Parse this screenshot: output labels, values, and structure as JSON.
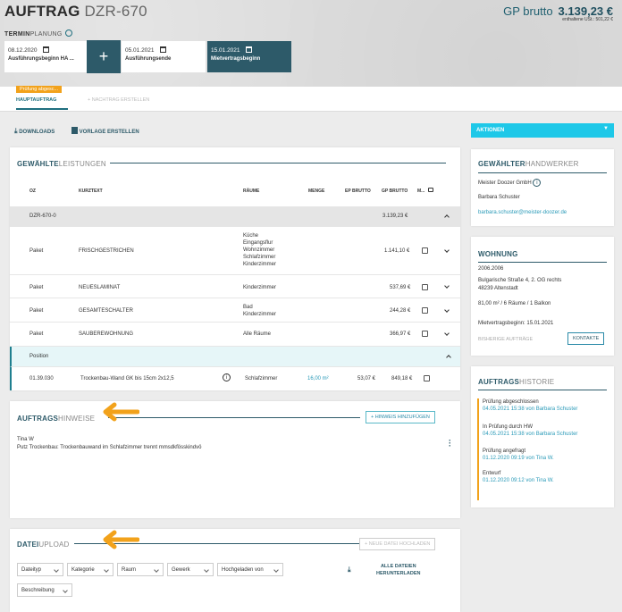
{
  "header": {
    "title_bold": "AUFTRAG",
    "title_id": "DZR-670",
    "gp_label": "GP brutto",
    "gp_amount": "3.139,23 €",
    "ust": "enthaltene USt.: 501,22 €",
    "termin_bold": "TERMIN",
    "termin_rest": "PLANUNG"
  },
  "steps": [
    {
      "date": "08.12.2020",
      "label": "Ausführungsbeginn HA ..."
    },
    {
      "date": "05.01.2021",
      "label": "Ausführungsende"
    },
    {
      "date": "15.01.2021",
      "label": "Mietvertragsbeginn"
    }
  ],
  "tabs": {
    "badge": "Prüfung abgesc...",
    "main": "HAUPTAUFTRAG",
    "add": "NACHTRAG ERSTELLEN"
  },
  "toolbar": {
    "downloads": "DOWNLOADS",
    "vorlage": "VORLAGE ERSTELLEN",
    "aktionen": "AKTIONEN"
  },
  "leistungen": {
    "title_bold": "GEWÄHLTE",
    "title_rest": "LEISTUNGEN",
    "cols": [
      "OZ",
      "KURZTEXT",
      "RÄUME",
      "MENGE",
      "EP BRUTTO",
      "GP BRUTTO",
      "M..."
    ],
    "group": {
      "oz": "DZR-670-0",
      "gp": "3.139,23 €"
    },
    "rows": [
      {
        "oz": "Paket",
        "text": "FRISCHGESTRICHEN",
        "raeume": [
          "Küche",
          "Eingangsflur",
          "Wohnzimmer",
          "Schlafzimmer",
          "Kinderzimmer"
        ],
        "gp": "1.141,10 €"
      },
      {
        "oz": "Paket",
        "text": "NEUESLAMINAT",
        "raeume": [
          "Kinderzimmer"
        ],
        "gp": "537,69 €"
      },
      {
        "oz": "Paket",
        "text": "GESAMTESCHALTER",
        "raeume": [
          "Bad",
          "Kinderzimmer"
        ],
        "gp": "244,28 €"
      },
      {
        "oz": "Paket",
        "text": "SAUBEREWOHNUNG",
        "raeume": [
          "Alle Räume"
        ],
        "gp": "366,97 €"
      }
    ],
    "position_label": "Position",
    "position": {
      "oz": "01.39.030",
      "text": "Trockenbau-Wand GK bis 15cm 2x12,5",
      "raeume": "Schlafzimmer",
      "menge": "16,00 m²",
      "ep": "53,07 €",
      "gp": "849,18 €"
    }
  },
  "hinweise": {
    "title_bold": "AUFTRAGS",
    "title_rest": "HINWEISE",
    "button": "HINWEIS HINZUFÜGEN",
    "author": "Tina W",
    "text": "Putz Trockenbau: Trockenbauwand im Schlafzimmer trennt mmsdkfösskindvö"
  },
  "upload": {
    "title_bold": "DATEI",
    "title_rest": "UPLOAD",
    "button": "NEUE DATEI HOCHLADEN",
    "filters": [
      "Dateityp",
      "Kategorie",
      "Raum",
      "Gewerk",
      "Hochgeladen von",
      "Beschreibung"
    ],
    "download_all_1": "ALLE DATEIEN",
    "download_all_2": "HERUNTERLADEN"
  },
  "handwerker": {
    "title_bold": "GEWÄHLTER",
    "title_rest": "HANDWERKER",
    "company": "Meister Doozer GmbH",
    "person": "Barbara Schuster",
    "email": "barbara.schuster@meister-doozer.de"
  },
  "wohnung": {
    "title": "WOHNUNG",
    "id": "2006.2006",
    "address1": "Bulgarische Straße 4, 2. OG rechts",
    "address2": "48239 Altenstadt",
    "details": "81,00 m² / 6 Räume / 1 Balkon",
    "miet": "Mietvertragsbeginn: 15.01.2021",
    "bisherige": "BISHERIGE AUFTRÄGE",
    "kontakte": "KONTAKTE"
  },
  "historie": {
    "title_bold": "AUFTRAGS",
    "title_rest": "HISTORIE",
    "items": [
      {
        "t": "Prüfung abgeschlossen",
        "s": "04.05.2021 15:38 von Barbara Schuster"
      },
      {
        "t": "In Prüfung durch HW",
        "s": "04.05.2021 15:38 von Barbara Schuster"
      },
      {
        "t": "Prüfung angefragt",
        "s": "01.12.2020 09:19 von Tina W."
      },
      {
        "t": "Entwurf",
        "s": "01.12.2020 09:12 von Tina W."
      }
    ]
  },
  "colors": {
    "dark_teal": "#2d5a69",
    "accent_cyan": "#1ec8e8",
    "orange": "#f2a21b"
  }
}
